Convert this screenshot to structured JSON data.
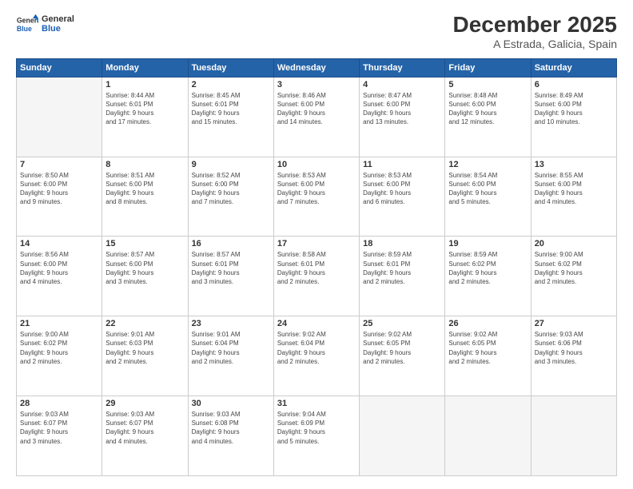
{
  "logo": {
    "line1": "General",
    "line2": "Blue"
  },
  "title": "December 2025",
  "location": "A Estrada, Galicia, Spain",
  "days_of_week": [
    "Sunday",
    "Monday",
    "Tuesday",
    "Wednesday",
    "Thursday",
    "Friday",
    "Saturday"
  ],
  "weeks": [
    [
      {
        "num": "",
        "info": ""
      },
      {
        "num": "1",
        "info": "Sunrise: 8:44 AM\nSunset: 6:01 PM\nDaylight: 9 hours\nand 17 minutes."
      },
      {
        "num": "2",
        "info": "Sunrise: 8:45 AM\nSunset: 6:01 PM\nDaylight: 9 hours\nand 15 minutes."
      },
      {
        "num": "3",
        "info": "Sunrise: 8:46 AM\nSunset: 6:00 PM\nDaylight: 9 hours\nand 14 minutes."
      },
      {
        "num": "4",
        "info": "Sunrise: 8:47 AM\nSunset: 6:00 PM\nDaylight: 9 hours\nand 13 minutes."
      },
      {
        "num": "5",
        "info": "Sunrise: 8:48 AM\nSunset: 6:00 PM\nDaylight: 9 hours\nand 12 minutes."
      },
      {
        "num": "6",
        "info": "Sunrise: 8:49 AM\nSunset: 6:00 PM\nDaylight: 9 hours\nand 10 minutes."
      }
    ],
    [
      {
        "num": "7",
        "info": "Sunrise: 8:50 AM\nSunset: 6:00 PM\nDaylight: 9 hours\nand 9 minutes."
      },
      {
        "num": "8",
        "info": "Sunrise: 8:51 AM\nSunset: 6:00 PM\nDaylight: 9 hours\nand 8 minutes."
      },
      {
        "num": "9",
        "info": "Sunrise: 8:52 AM\nSunset: 6:00 PM\nDaylight: 9 hours\nand 7 minutes."
      },
      {
        "num": "10",
        "info": "Sunrise: 8:53 AM\nSunset: 6:00 PM\nDaylight: 9 hours\nand 7 minutes."
      },
      {
        "num": "11",
        "info": "Sunrise: 8:53 AM\nSunset: 6:00 PM\nDaylight: 9 hours\nand 6 minutes."
      },
      {
        "num": "12",
        "info": "Sunrise: 8:54 AM\nSunset: 6:00 PM\nDaylight: 9 hours\nand 5 minutes."
      },
      {
        "num": "13",
        "info": "Sunrise: 8:55 AM\nSunset: 6:00 PM\nDaylight: 9 hours\nand 4 minutes."
      }
    ],
    [
      {
        "num": "14",
        "info": "Sunrise: 8:56 AM\nSunset: 6:00 PM\nDaylight: 9 hours\nand 4 minutes."
      },
      {
        "num": "15",
        "info": "Sunrise: 8:57 AM\nSunset: 6:00 PM\nDaylight: 9 hours\nand 3 minutes."
      },
      {
        "num": "16",
        "info": "Sunrise: 8:57 AM\nSunset: 6:01 PM\nDaylight: 9 hours\nand 3 minutes."
      },
      {
        "num": "17",
        "info": "Sunrise: 8:58 AM\nSunset: 6:01 PM\nDaylight: 9 hours\nand 2 minutes."
      },
      {
        "num": "18",
        "info": "Sunrise: 8:59 AM\nSunset: 6:01 PM\nDaylight: 9 hours\nand 2 minutes."
      },
      {
        "num": "19",
        "info": "Sunrise: 8:59 AM\nSunset: 6:02 PM\nDaylight: 9 hours\nand 2 minutes."
      },
      {
        "num": "20",
        "info": "Sunrise: 9:00 AM\nSunset: 6:02 PM\nDaylight: 9 hours\nand 2 minutes."
      }
    ],
    [
      {
        "num": "21",
        "info": "Sunrise: 9:00 AM\nSunset: 6:02 PM\nDaylight: 9 hours\nand 2 minutes."
      },
      {
        "num": "22",
        "info": "Sunrise: 9:01 AM\nSunset: 6:03 PM\nDaylight: 9 hours\nand 2 minutes."
      },
      {
        "num": "23",
        "info": "Sunrise: 9:01 AM\nSunset: 6:04 PM\nDaylight: 9 hours\nand 2 minutes."
      },
      {
        "num": "24",
        "info": "Sunrise: 9:02 AM\nSunset: 6:04 PM\nDaylight: 9 hours\nand 2 minutes."
      },
      {
        "num": "25",
        "info": "Sunrise: 9:02 AM\nSunset: 6:05 PM\nDaylight: 9 hours\nand 2 minutes."
      },
      {
        "num": "26",
        "info": "Sunrise: 9:02 AM\nSunset: 6:05 PM\nDaylight: 9 hours\nand 2 minutes."
      },
      {
        "num": "27",
        "info": "Sunrise: 9:03 AM\nSunset: 6:06 PM\nDaylight: 9 hours\nand 3 minutes."
      }
    ],
    [
      {
        "num": "28",
        "info": "Sunrise: 9:03 AM\nSunset: 6:07 PM\nDaylight: 9 hours\nand 3 minutes."
      },
      {
        "num": "29",
        "info": "Sunrise: 9:03 AM\nSunset: 6:07 PM\nDaylight: 9 hours\nand 4 minutes."
      },
      {
        "num": "30",
        "info": "Sunrise: 9:03 AM\nSunset: 6:08 PM\nDaylight: 9 hours\nand 4 minutes."
      },
      {
        "num": "31",
        "info": "Sunrise: 9:04 AM\nSunset: 6:09 PM\nDaylight: 9 hours\nand 5 minutes."
      },
      {
        "num": "",
        "info": ""
      },
      {
        "num": "",
        "info": ""
      },
      {
        "num": "",
        "info": ""
      }
    ]
  ]
}
